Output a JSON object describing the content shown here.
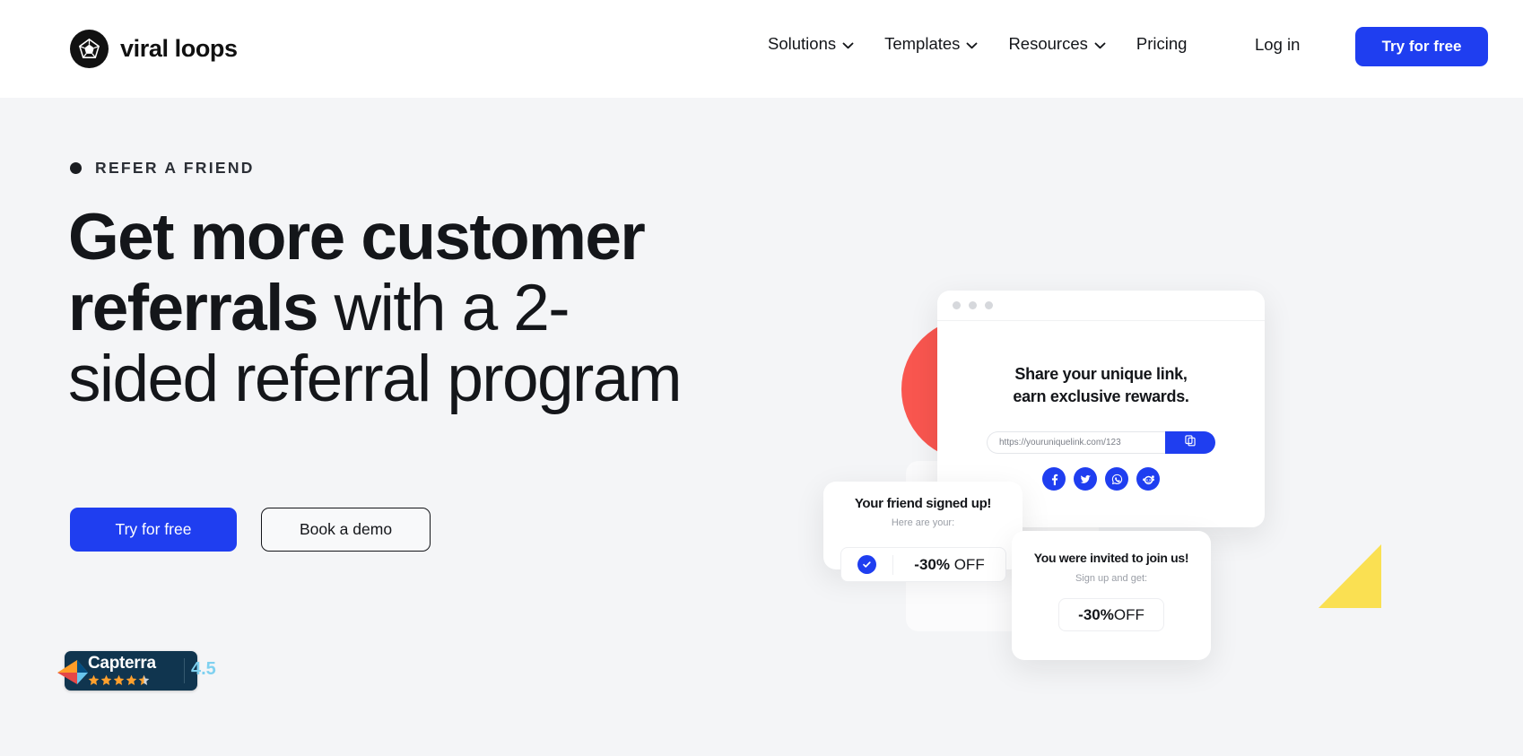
{
  "brand": {
    "name": "viral loops",
    "logo_icon": "polyhedron-icon",
    "accent_blue": "#1f3ef0",
    "hero_bg": "#f4f5f7",
    "shape_red": "#f9564f",
    "shape_yellow": "#fae052",
    "text_dark": "#14161a"
  },
  "header": {
    "nav": [
      {
        "label": "Solutions",
        "has_dropdown": true
      },
      {
        "label": "Templates",
        "has_dropdown": true
      },
      {
        "label": "Resources",
        "has_dropdown": true
      },
      {
        "label": "Pricing",
        "has_dropdown": false
      }
    ],
    "login_label": "Log in",
    "cta_label": "Try for free"
  },
  "hero": {
    "eyebrow": "REFER A FRIEND",
    "headline_bold_1": "Get more customer",
    "headline_bold_2": "referrals",
    "headline_light_1": " with a",
    "headline_light_2": "2-sided referral",
    "headline_light_3": "program",
    "primary_button": "Try for free",
    "secondary_button": "Book a demo"
  },
  "capterra": {
    "name": "Capterra",
    "score": "4.5",
    "stars": 4.5
  },
  "illustration": {
    "browser_card": {
      "title_line_1": "Share your unique link,",
      "title_line_2": "earn exclusive rewards.",
      "link_value": "https://youruniquelink.com/123",
      "copy_icon": "copy-icon",
      "socials": [
        "facebook-icon",
        "twitter-icon",
        "whatsapp-icon",
        "reddit-icon"
      ]
    },
    "friend_card": {
      "title": "Your friend signed up!",
      "subtitle": "Here are your:",
      "check_icon": "check-circle-icon",
      "reward_amount": "-30%",
      "reward_suffix": " OFF"
    },
    "invite_card": {
      "title": "You were invited to join us!",
      "subtitle": "Sign up and get:",
      "reward_amount": "-30%",
      "reward_suffix": " OFF"
    }
  }
}
